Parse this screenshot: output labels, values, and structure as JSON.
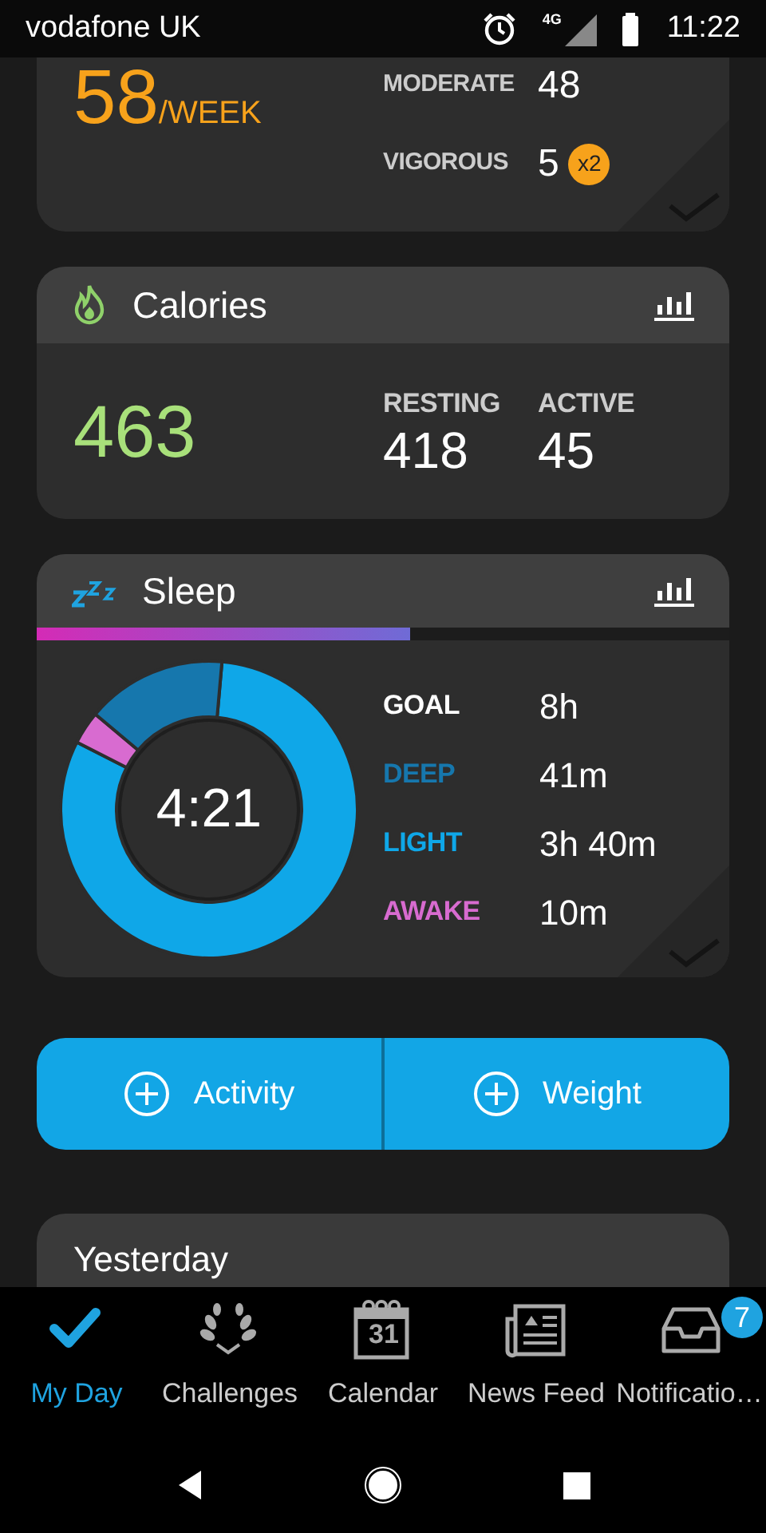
{
  "status_bar": {
    "carrier": "vodafone UK",
    "network": "4G",
    "time": "11:22"
  },
  "intensity_card": {
    "value": "58",
    "unit": "/WEEK",
    "rows": [
      {
        "label": "MODERATE",
        "value": "48"
      },
      {
        "label": "VIGOROUS",
        "value": "5",
        "multiplier": "x2"
      }
    ]
  },
  "calories_card": {
    "title": "Calories",
    "total": "463",
    "stats": [
      {
        "label": "RESTING",
        "value": "418"
      },
      {
        "label": "ACTIVE",
        "value": "45"
      }
    ]
  },
  "sleep_card": {
    "title": "Sleep",
    "level": 0.54,
    "total": "4:21",
    "legend": [
      {
        "label": "GOAL",
        "value": "8h",
        "color": "#ffffff"
      },
      {
        "label": "DEEP",
        "value": "41m",
        "color": "#1677ad"
      },
      {
        "label": "LIGHT",
        "value": "3h 40m",
        "color": "#0fa7e8"
      },
      {
        "label": "AWAKE",
        "value": "10m",
        "color": "#d86bd0"
      }
    ]
  },
  "add_buttons": [
    {
      "label": "Activity"
    },
    {
      "label": "Weight"
    }
  ],
  "yesterday_card": {
    "title": "Yesterday"
  },
  "bottom_nav": [
    {
      "label": "My Day",
      "selected": true
    },
    {
      "label": "Challenges",
      "selected": false
    },
    {
      "label": "Calendar",
      "selected": false,
      "icon_text": "31"
    },
    {
      "label": "News Feed",
      "selected": false
    },
    {
      "label": "Notificatio…",
      "selected": false,
      "badge": "7"
    }
  ]
}
